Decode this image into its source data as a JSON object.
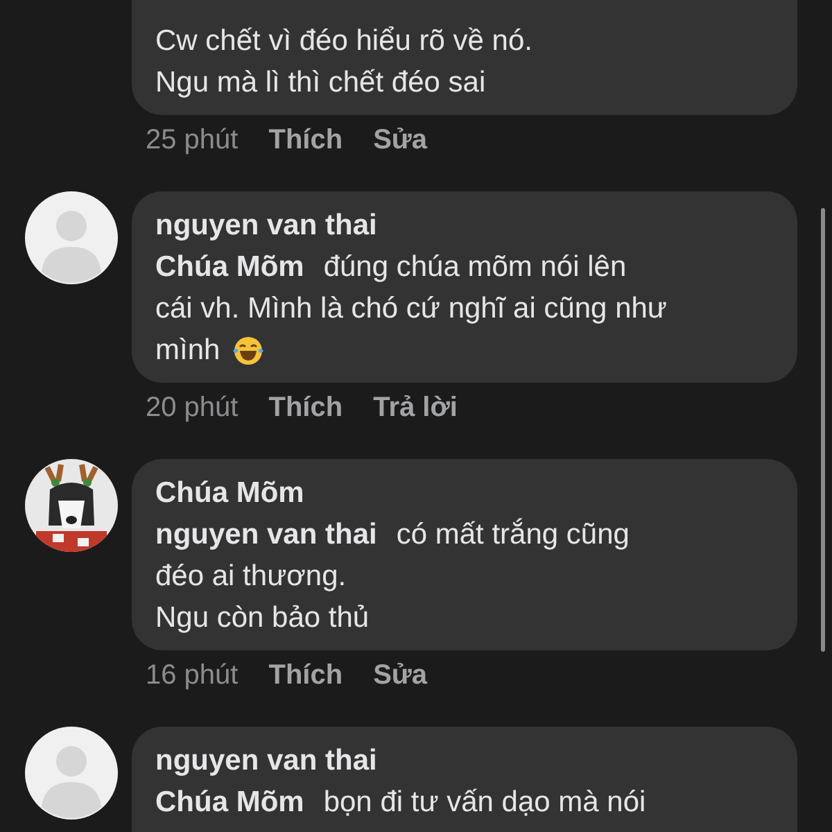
{
  "comments": [
    {
      "lines": [
        "Cw chết vì đéo hiểu rõ về nó.",
        "Ngu mà lì thì chết đéo sai"
      ],
      "time": "25 phút",
      "actions": [
        "Thích",
        "Sửa"
      ]
    },
    {
      "avatar": {
        "kind": "silhouette"
      },
      "author": "nguyen van thai",
      "mention": "Chúa Mõm",
      "lines": [
        "đúng chúa mõm nói lên",
        "cái vh. Mình là chó cứ nghĩ ai cũng như",
        "mình"
      ],
      "emoji": {
        "kind": "laugh"
      },
      "time": "20 phút",
      "actions": [
        "Thích",
        "Trả lời"
      ]
    },
    {
      "avatar": {
        "kind": "picture"
      },
      "author": "Chúa Mõm",
      "mention": "nguyen van thai",
      "lines": [
        "có mất trắng cũng",
        "đéo ai thương.",
        "Ngu còn bảo thủ"
      ],
      "time": "16 phút",
      "actions": [
        "Thích",
        "Sửa"
      ]
    },
    {
      "avatar": {
        "kind": "silhouette"
      },
      "author": "nguyen van thai",
      "mention": "Chúa Mõm",
      "lines": [
        "bọn đi tư vấn dạo mà nói"
      ]
    }
  ]
}
